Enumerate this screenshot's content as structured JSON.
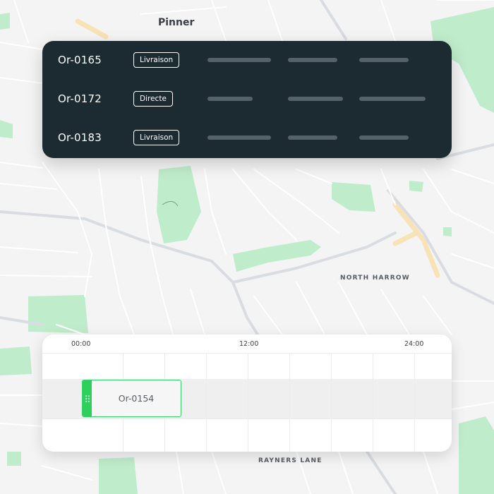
{
  "map": {
    "labels": {
      "pinner": "Pinner",
      "north_harrow": "NORTH HARROW",
      "rayners_lane": "RAYNERS LANE"
    },
    "colors": {
      "background": "#f4f4f4",
      "road": "#ffffff",
      "road_major": "#d9dde1",
      "park": "#bfeccb",
      "accent_road": "#f7e3b5"
    }
  },
  "orders": {
    "rows": [
      {
        "id": "Or-0165",
        "type": "Livraison"
      },
      {
        "id": "Or-0172",
        "type": "Directe"
      },
      {
        "id": "Or-0183",
        "type": "Livraison"
      }
    ],
    "colors": {
      "panel": "#1c2a31",
      "placeholder": "#55626a",
      "text": "#ffffff"
    }
  },
  "timeline": {
    "ticks": [
      "00:00",
      "12:00",
      "24:00"
    ],
    "task": {
      "id": "Or-0154",
      "start_hour": 0.5,
      "end_hour": 7.5
    },
    "colors": {
      "task_accent": "#2ed05c"
    }
  }
}
